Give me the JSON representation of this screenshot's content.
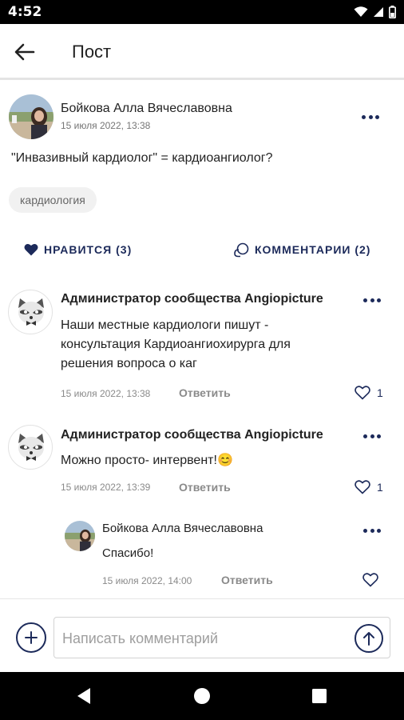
{
  "status_bar": {
    "time": "4:52",
    "icons": [
      "wifi-icon",
      "cellular-signal-icon",
      "battery-icon"
    ]
  },
  "app_bar": {
    "title": "Пост",
    "back_icon": "arrow-left-icon"
  },
  "post": {
    "author": "Бойкова Алла Вячеславовна",
    "date": "15 июля 2022, 13:38",
    "text": "\"Инвазивный кардиолог\" = кардиоангиолог?",
    "tag": "кардиология",
    "like_label": "НРАВИТСЯ (3)",
    "comments_label": "КОММЕНТАРИИ (2)"
  },
  "comments": [
    {
      "author": "Администратор сообщества Angiopicture",
      "text_lines": [
        "Наши местные кардиологи пишут -",
        "консультация Кардиоангиохирурга для",
        "решения вопроса о каг"
      ],
      "date": "15 июля 2022, 13:38",
      "reply_label": "Ответить",
      "likes": "1"
    },
    {
      "author": "Администратор сообщества Angiopicture",
      "text": "Можно просто- интервент!😊",
      "date": "15 июля 2022, 13:39",
      "reply_label": "Ответить",
      "likes": "1",
      "replies": [
        {
          "author": "Бойкова Алла Вячеславовна",
          "text": "Спасибо!",
          "date": "15 июля 2022, 14:00",
          "reply_label": "Ответить"
        }
      ]
    }
  ],
  "comment_input": {
    "placeholder": "Написать комментарий",
    "value": ""
  },
  "colors": {
    "accent": "#1c2a5a",
    "muted_text": "#8a8a8a",
    "chip_bg": "#f1f1f1"
  }
}
